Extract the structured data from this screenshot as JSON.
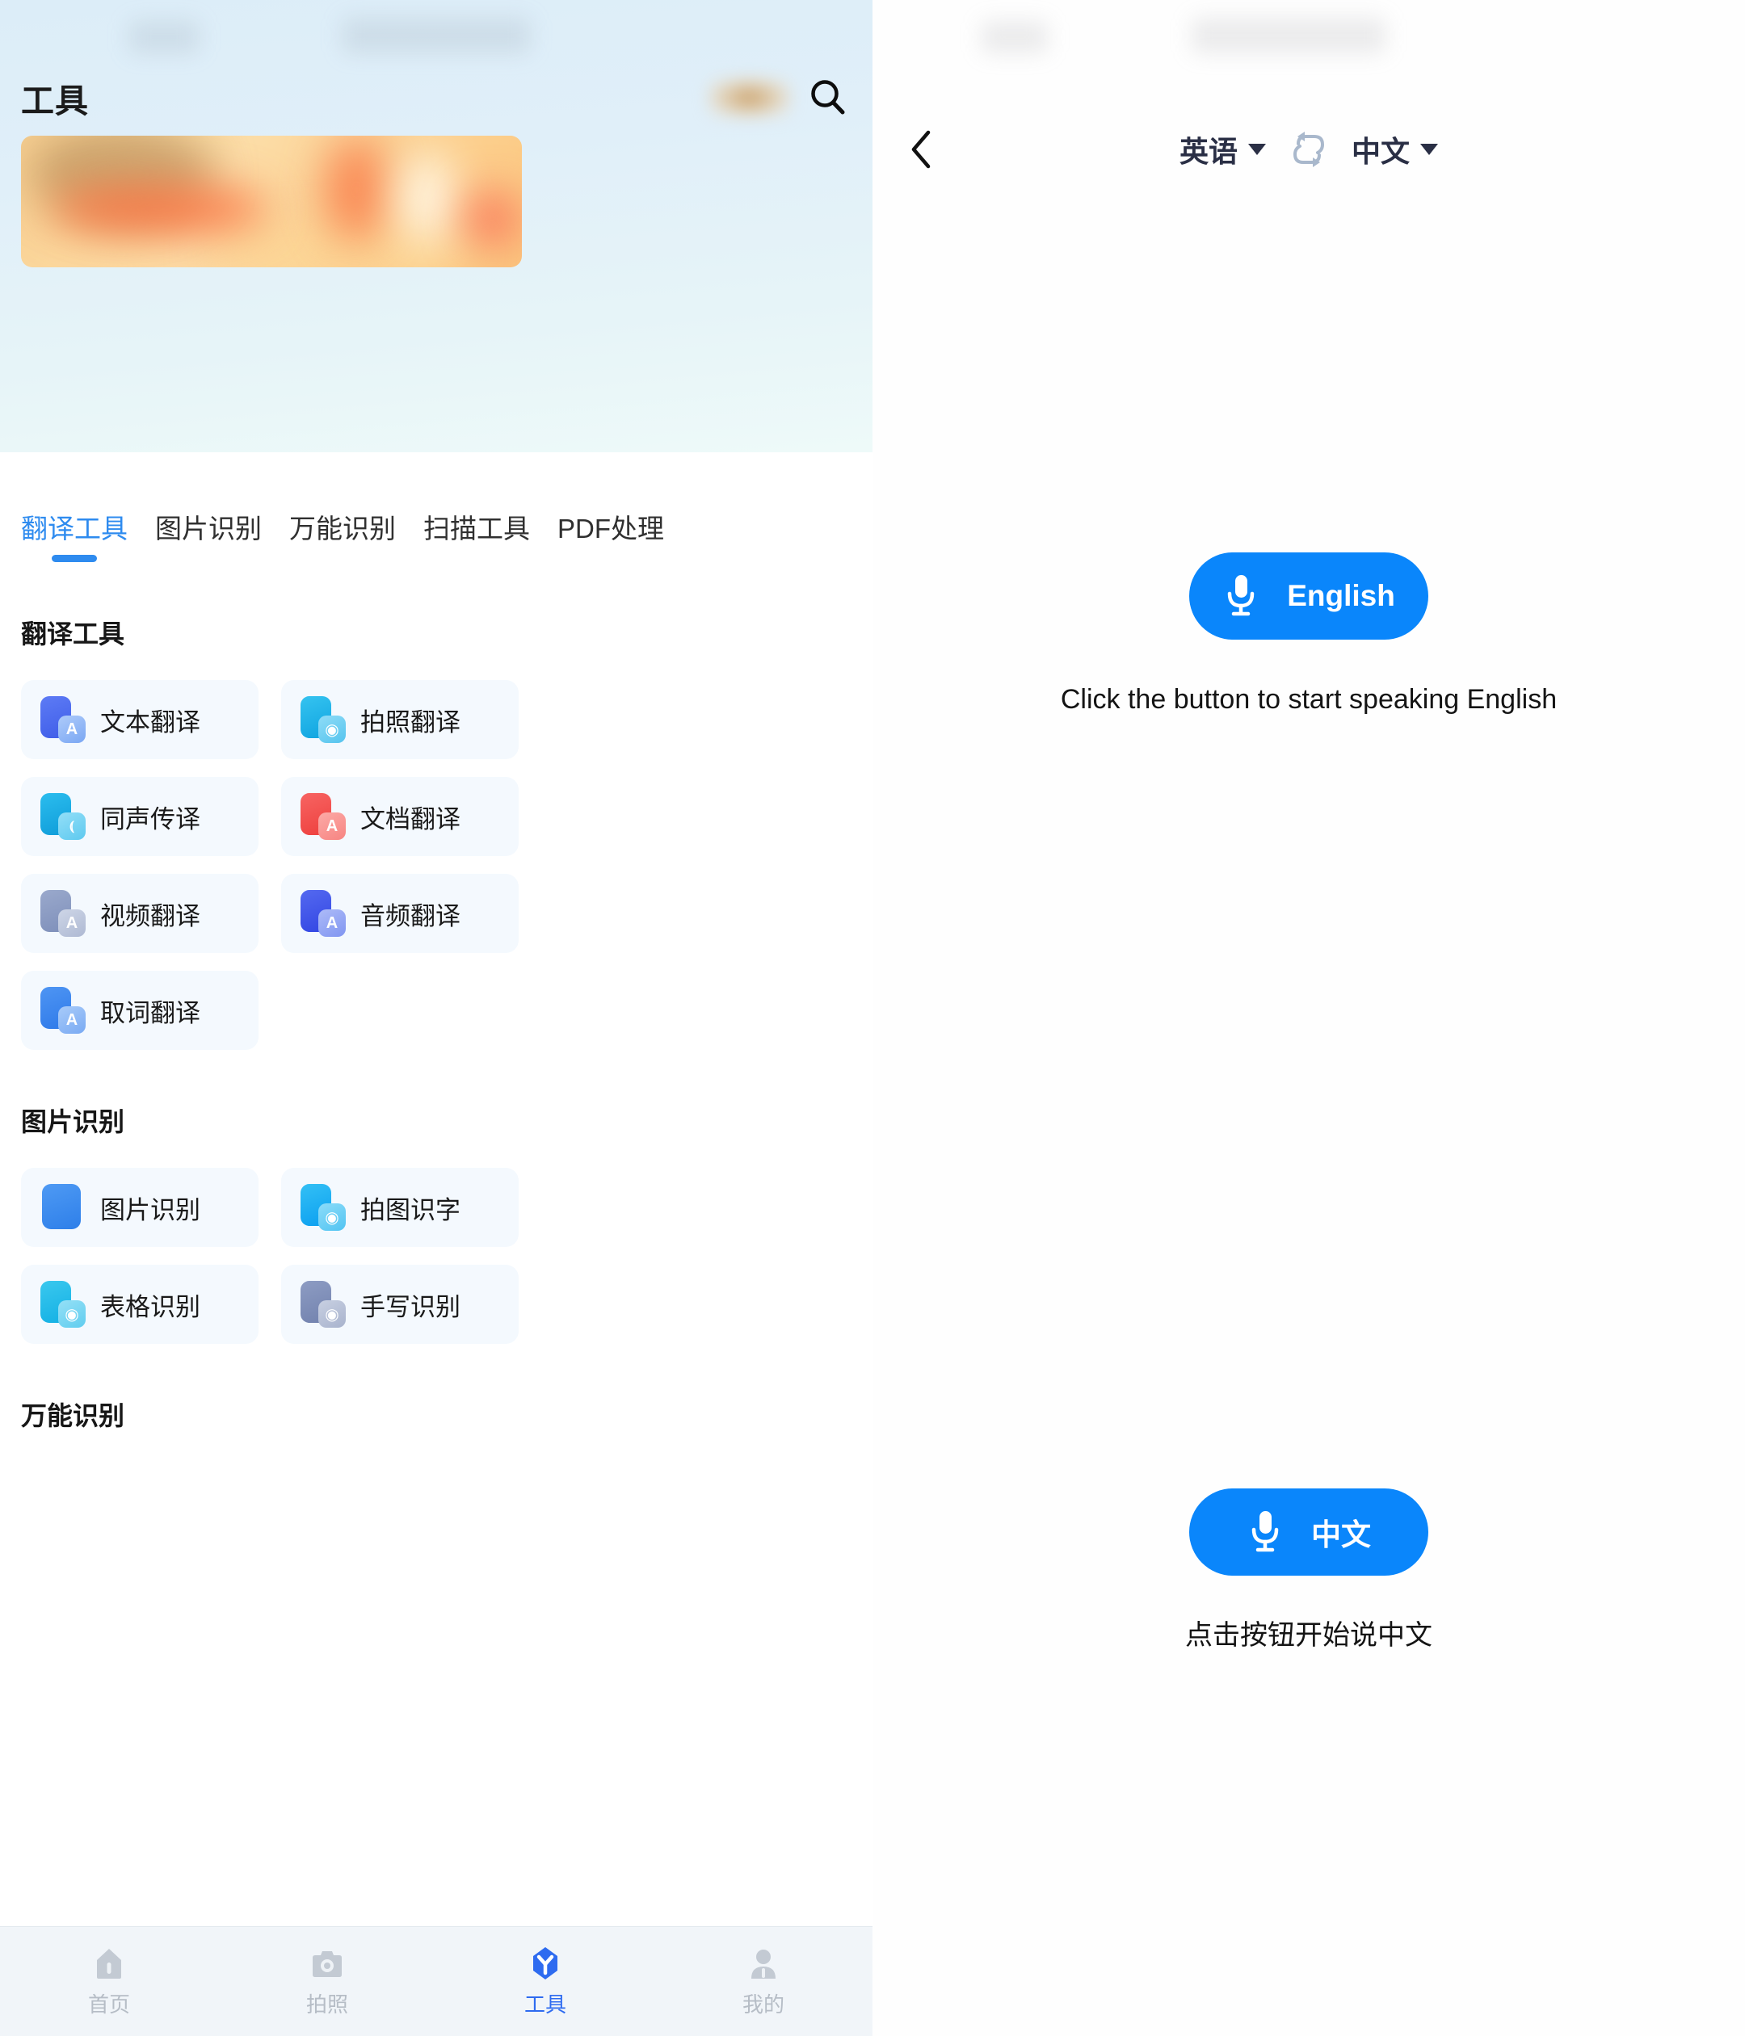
{
  "left_screen": {
    "title": "工具",
    "search_icon": "search-icon",
    "tabs": [
      {
        "label": "翻译工具",
        "active": true
      },
      {
        "label": "图片识别",
        "active": false
      },
      {
        "label": "万能识别",
        "active": false
      },
      {
        "label": "扫描工具",
        "active": false
      },
      {
        "label": "PDF处理",
        "active": false
      }
    ],
    "sections": [
      {
        "heading": "翻译工具",
        "items": [
          {
            "label": "文本翻译",
            "icon": "text-translate-icon",
            "base_color": "#4f6ef0",
            "badge_color": "#9fc0f8",
            "badge_glyph": "A"
          },
          {
            "label": "拍照翻译",
            "icon": "photo-translate-icon",
            "base_color": "#1db7e8",
            "badge_color": "#74cff3",
            "badge_glyph": "◉"
          },
          {
            "label": "同声传译",
            "icon": "simultaneous-interpret-icon",
            "base_color": "#19a9e0",
            "badge_color": "#7ed2f2",
            "badge_glyph": "((·"
          },
          {
            "label": "文档翻译",
            "icon": "document-translate-icon",
            "base_color": "#f0504e",
            "badge_color": "#f79a97",
            "badge_glyph": "A"
          },
          {
            "label": "视频翻译",
            "icon": "video-translate-icon",
            "base_color": "#8b9bc4",
            "badge_color": "#c2cbdf",
            "badge_glyph": "A"
          },
          {
            "label": "音频翻译",
            "icon": "audio-translate-icon",
            "base_color": "#4258e8",
            "badge_color": "#9dadf5",
            "badge_glyph": "A"
          },
          {
            "label": "取词翻译",
            "icon": "word-lookup-translate-icon",
            "base_color": "#3f86ef",
            "badge_color": "#9ac4f7",
            "badge_glyph": "A"
          }
        ]
      },
      {
        "heading": "图片识别",
        "items": [
          {
            "label": "图片识别",
            "icon": "image-recognition-icon",
            "base_color": "#3f8ef0",
            "badge_color": "#8fc0f6",
            "badge_glyph": "⬓"
          },
          {
            "label": "拍图识字",
            "icon": "photo-ocr-icon",
            "base_color": "#17b0f0",
            "badge_color": "#76cef5",
            "badge_glyph": "◉"
          },
          {
            "label": "表格识别",
            "icon": "table-recognition-icon",
            "base_color": "#21b9e8",
            "badge_color": "#7fd5f2",
            "badge_glyph": "◉"
          },
          {
            "label": "手写识别",
            "icon": "handwriting-recognition-icon",
            "base_color": "#7f8fb8",
            "badge_color": "#bdc6da",
            "badge_glyph": "◉"
          }
        ]
      },
      {
        "heading": "万能识别",
        "items": []
      }
    ],
    "bottom_nav": [
      {
        "label": "首页",
        "icon": "home-icon",
        "active": false
      },
      {
        "label": "拍照",
        "icon": "camera-icon",
        "active": false
      },
      {
        "label": "工具",
        "icon": "tools-icon",
        "active": true
      },
      {
        "label": "我的",
        "icon": "profile-icon",
        "active": false
      }
    ]
  },
  "right_screen": {
    "back_icon": "back-chevron-icon",
    "source_language": "英语",
    "swap_icon": "swap-languages-icon",
    "target_language": "中文",
    "top_mic": {
      "icon": "microphone-icon",
      "label": "English",
      "hint": "Click the button to start speaking English"
    },
    "bottom_mic": {
      "icon": "microphone-icon",
      "label": "中文",
      "hint": "点击按钮开始说中文"
    }
  },
  "colors": {
    "accent_blue": "#0a86fb",
    "tab_active_blue": "#2e8bef",
    "nav_active_blue": "#2e6bf0",
    "card_background": "#f4f9fe",
    "left_top_gradient_start": "#dcedf8",
    "left_top_gradient_end": "#eefaf9",
    "bottom_nav_background": "#f1f5f9"
  }
}
